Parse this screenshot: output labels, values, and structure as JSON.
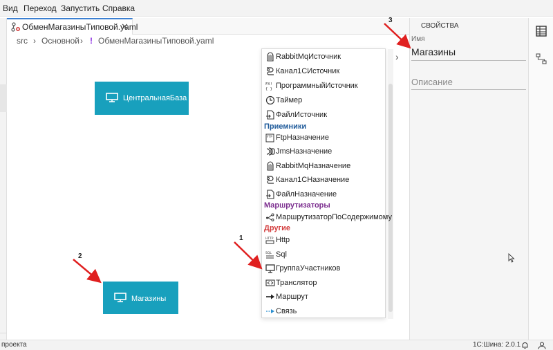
{
  "menubar": {
    "items": [
      {
        "label": "Вид"
      },
      {
        "label": "Переход"
      },
      {
        "label": "Запустить"
      },
      {
        "label": "Справка"
      }
    ]
  },
  "editor": {
    "tab_label": "ОбменМагазиныТиповой.yaml",
    "breadcrumb": [
      "src",
      "Основной",
      "ОбменМагазиныТиповой.yaml"
    ],
    "nodes": [
      {
        "label": "ЦентральнаяБаза"
      },
      {
        "label": "Магазины"
      }
    ]
  },
  "palette": {
    "items_top": [
      {
        "label": "RabbitMqИсточник",
        "icon": "rabbit-icon"
      },
      {
        "label": "Канал1СИсточник",
        "icon": "channel-1c-icon"
      },
      {
        "label": "ПрограммныйИсточник",
        "icon": "code-icon"
      },
      {
        "label": "Таймер",
        "icon": "clock-icon"
      },
      {
        "label": "ФайлИсточник",
        "icon": "file-icon"
      }
    ],
    "section_receivers": "Приемники",
    "items_receivers": [
      {
        "label": "FtpНазначение",
        "icon": "ftp-icon"
      },
      {
        "label": "JmsНазначение",
        "icon": "jms-icon"
      },
      {
        "label": "RabbitMqНазначение",
        "icon": "rabbit-icon"
      },
      {
        "label": "Канал1СНазначение",
        "icon": "channel-1c-icon"
      },
      {
        "label": "ФайлНазначение",
        "icon": "file-icon"
      }
    ],
    "section_routers": "Маршрутизаторы",
    "items_routers": [
      {
        "label": "МаршрутизаторПоСодержимому",
        "icon": "router-icon"
      }
    ],
    "section_other": "Другие",
    "items_other": [
      {
        "label": "Http",
        "icon": "http-icon"
      },
      {
        "label": "Sql",
        "icon": "sql-icon"
      },
      {
        "label": "ГруппаУчастников",
        "icon": "monitor-icon"
      },
      {
        "label": "Транслятор",
        "icon": "translator-icon"
      },
      {
        "label": "Маршрут",
        "icon": "arrow-right-icon"
      },
      {
        "label": "Связь",
        "icon": "link-icon"
      }
    ],
    "colors": {
      "receivers": "#1e5a9a",
      "routers": "#7b2d8e",
      "other": "#d23c3c"
    }
  },
  "properties": {
    "title": "СВОЙСТВА",
    "name_label": "Имя",
    "name_value": "Магазины",
    "description_placeholder": "Описание"
  },
  "status": {
    "left": "проекта",
    "version": "1С:Шина: 2.0.1"
  },
  "annotations": [
    "1",
    "2",
    "3"
  ],
  "colors": {
    "node": "#18a0bd",
    "arrow": "#e02020",
    "accent_tab": "#3b7fd1"
  }
}
